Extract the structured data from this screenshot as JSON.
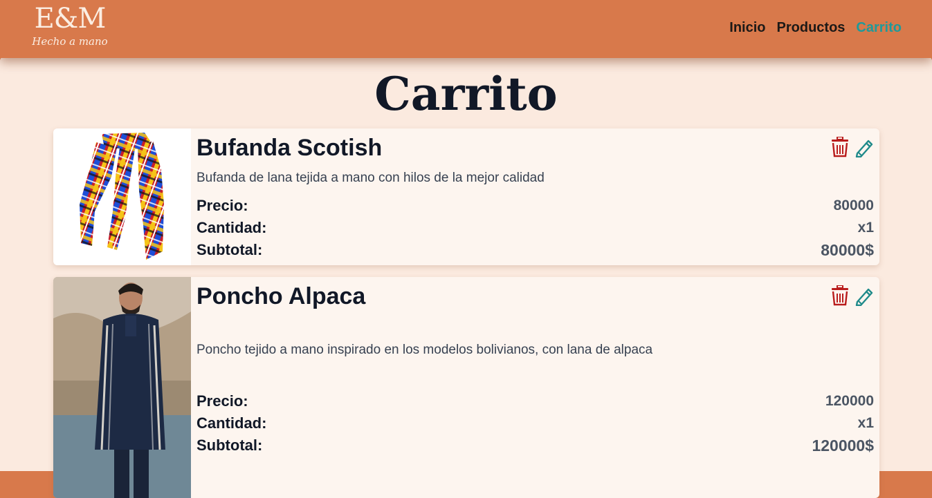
{
  "brand": {
    "name": "E&M",
    "tagline": "Hecho a mano"
  },
  "nav": {
    "items": [
      {
        "label": "Inicio",
        "active": false
      },
      {
        "label": "Productos",
        "active": false
      },
      {
        "label": "Carrito",
        "active": true
      }
    ]
  },
  "page": {
    "title": "Carrito"
  },
  "cart": {
    "items": [
      {
        "name": "Bufanda Scotish",
        "description": "Bufanda de lana tejida a mano con hilos de la mejor calidad",
        "price_label": "Precio:",
        "price": "80000",
        "qty_label": "Cantidad:",
        "qty": "x1",
        "subtotal_label": "Subtotal:",
        "subtotal": "80000$"
      },
      {
        "name": "Poncho Alpaca",
        "description": "Poncho tejido a mano inspirado en los modelos bolivianos, con lana de alpaca",
        "price_label": "Precio:",
        "price": "120000",
        "qty_label": "Cantidad:",
        "qty": "x1",
        "subtotal_label": "Subtotal:",
        "subtotal": "120000$"
      }
    ]
  },
  "icons": {
    "delete": "trash-icon",
    "edit": "pencil-icon"
  },
  "colors": {
    "header": "#d8794b",
    "background": "#fbeadf",
    "card": "#fdf5ef",
    "accent": "#1f9a9a",
    "danger": "#b91c1c",
    "text": "#111827"
  }
}
